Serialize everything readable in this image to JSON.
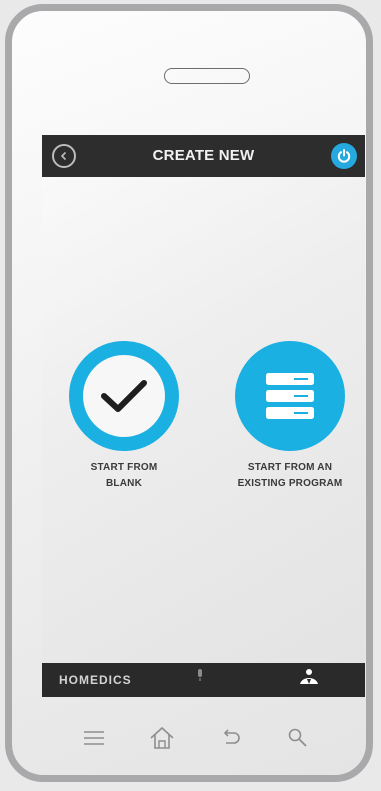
{
  "header": {
    "title": "CREATE NEW",
    "back_icon": "back-icon",
    "power_icon": "power-icon",
    "accent_color": "#1ab0e2"
  },
  "options": [
    {
      "label": "START FROM BLANK",
      "icon": "checkmark-icon"
    },
    {
      "label": "START FROM AN EXISTING PROGRAM",
      "icon": "list-icon"
    }
  ],
  "bottom_bar": {
    "brand": "HOMEDICS",
    "tabs": [
      {
        "icon": "microphone-icon"
      },
      {
        "icon": "massage-user-icon",
        "active": true
      }
    ]
  },
  "nav_bar": {
    "buttons": [
      "menu-icon",
      "home-icon",
      "back-arrow-icon",
      "search-icon"
    ]
  }
}
